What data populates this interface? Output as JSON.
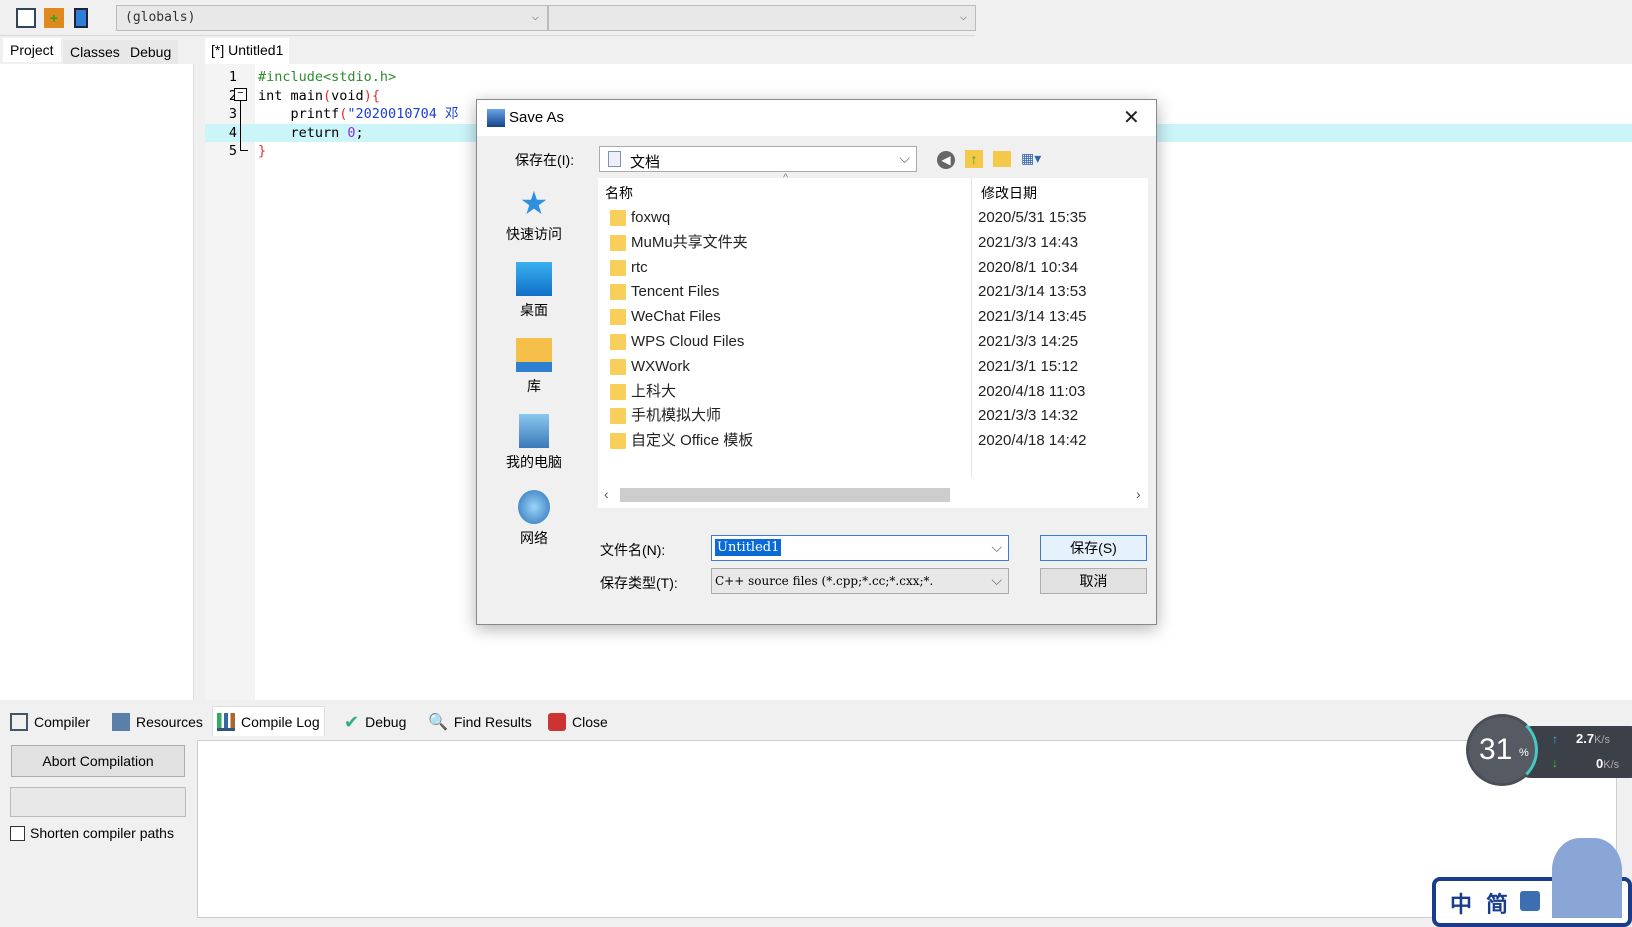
{
  "toolbar": {
    "globals_combo": "(globals)"
  },
  "left_tabs": [
    "Project",
    "Classes",
    "Debug"
  ],
  "editor": {
    "tab": "[*] Untitled1",
    "lines": [
      {
        "n": "1",
        "parts": [
          {
            "t": "#include<stdio.h>",
            "c": "#2e8b2e"
          }
        ]
      },
      {
        "n": "2",
        "parts": [
          {
            "t": "int main",
            "c": "#000"
          },
          {
            "t": "(",
            "c": "#e03030"
          },
          {
            "t": "void",
            "c": "#000"
          },
          {
            "t": "){",
            "c": "#e03030"
          }
        ]
      },
      {
        "n": "3",
        "parts": [
          {
            "t": "    printf",
            "c": "#000"
          },
          {
            "t": "(",
            "c": "#e03030"
          },
          {
            "t": "\"2020010704 邓",
            "c": "#1a3fd6"
          }
        ]
      },
      {
        "n": "4",
        "parts": [
          {
            "t": "    return ",
            "c": "#000"
          },
          {
            "t": "0",
            "c": "#8a2be2"
          },
          {
            "t": ";",
            "c": "#000"
          }
        ]
      },
      {
        "n": "5",
        "parts": [
          {
            "t": "}",
            "c": "#e03030"
          }
        ]
      }
    ]
  },
  "bottom_tabs": [
    "Compiler",
    "Resources",
    "Compile Log",
    "Debug",
    "Find Results",
    "Close"
  ],
  "compiler_panel": {
    "abort": "Abort Compilation",
    "shorten": "Shorten compiler paths"
  },
  "dialog": {
    "title": "Save As",
    "save_in_label": "保存在(I):",
    "save_in_value": "文档",
    "places": [
      "快速访问",
      "桌面",
      "库",
      "我的电脑",
      "网络"
    ],
    "col_name": "名称",
    "col_date": "修改日期",
    "files": [
      {
        "name": "foxwq",
        "date": "2020/5/31 15:35"
      },
      {
        "name": "MuMu共享文件夹",
        "date": "2021/3/3 14:43"
      },
      {
        "name": "rtc",
        "date": "2020/8/1 10:34"
      },
      {
        "name": "Tencent Files",
        "date": "2021/3/14 13:53"
      },
      {
        "name": "WeChat Files",
        "date": "2021/3/14 13:45"
      },
      {
        "name": "WPS Cloud Files",
        "date": "2021/3/3 14:25"
      },
      {
        "name": "WXWork",
        "date": "2021/3/1 15:12"
      },
      {
        "name": "上科大",
        "date": "2020/4/18 11:03"
      },
      {
        "name": "手机模拟大师",
        "date": "2021/3/3 14:32"
      },
      {
        "name": "自定义 Office 模板",
        "date": "2020/4/18 14:42"
      }
    ],
    "filename_label": "文件名(N):",
    "filename_value": "Untitled1",
    "filetype_label": "保存类型(T):",
    "filetype_value": "C++ source files (*.cpp;*.cc;*.cxx;*.",
    "save_btn": "保存(S)",
    "cancel_btn": "取消"
  },
  "widget": {
    "cpu": "31",
    "pct": "%",
    "up": "2.7",
    "down": "0",
    "unit": "K/s",
    "ime1": "中",
    "ime2": "简"
  }
}
